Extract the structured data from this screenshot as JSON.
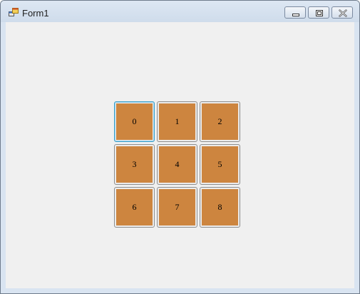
{
  "window": {
    "title": "Form1",
    "icon": "winforms-app-icon",
    "controls": [
      "minimize-icon",
      "maximize-icon",
      "close-icon"
    ]
  },
  "tiles": [
    {
      "label": "0",
      "focused": true
    },
    {
      "label": "1",
      "focused": false
    },
    {
      "label": "2",
      "focused": false
    },
    {
      "label": "3",
      "focused": false
    },
    {
      "label": "4",
      "focused": false
    },
    {
      "label": "5",
      "focused": false
    },
    {
      "label": "6",
      "focused": false
    },
    {
      "label": "7",
      "focused": false
    },
    {
      "label": "8",
      "focused": false
    }
  ],
  "colors": {
    "tile_face": "#cd853f",
    "form_background": "#f0f0f0",
    "focus_border": "#3b9ec9"
  }
}
